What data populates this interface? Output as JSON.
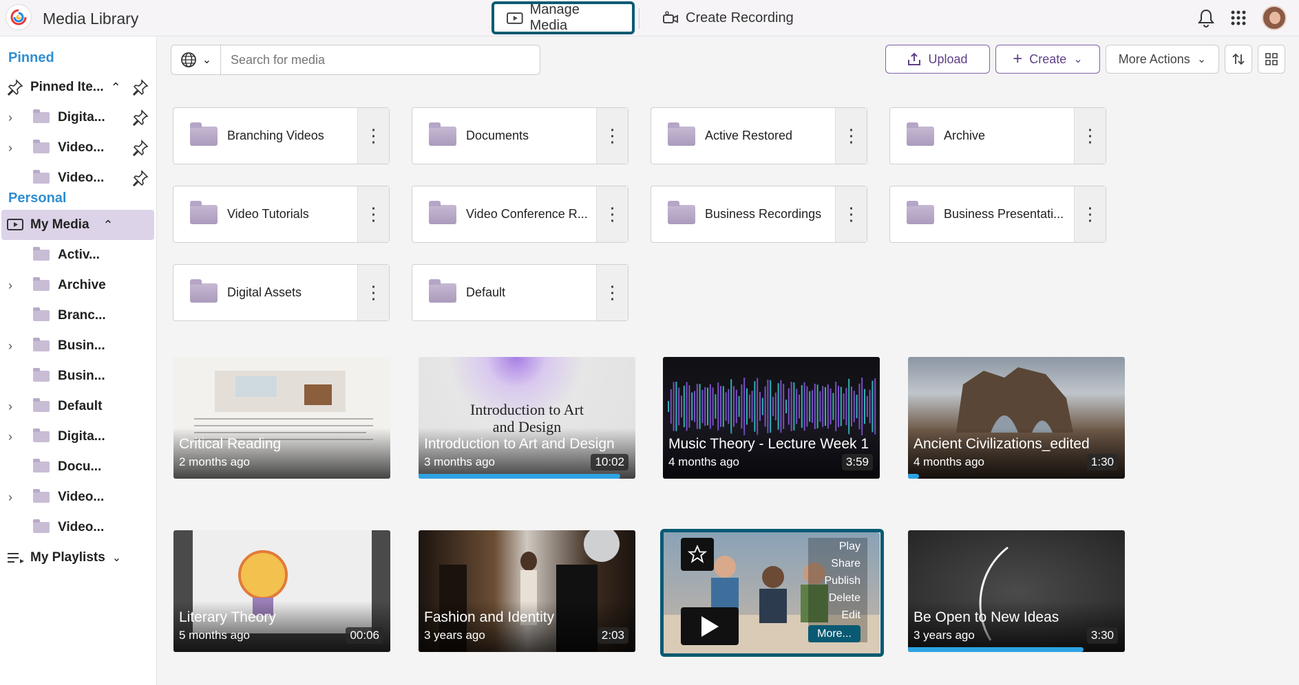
{
  "app": {
    "title": "Media Library"
  },
  "nav": {
    "tabs": [
      {
        "label": "Manage Media"
      },
      {
        "label": "Create Recording"
      }
    ]
  },
  "sidebar": {
    "pinned_title": "Pinned",
    "pinned_items": [
      {
        "label": "Pinned Ite..."
      },
      {
        "label": "Digita..."
      },
      {
        "label": "Video..."
      },
      {
        "label": "Video..."
      }
    ],
    "personal_title": "Personal",
    "my_media": "My Media",
    "folders": [
      {
        "label": "Activ..."
      },
      {
        "label": "Archive"
      },
      {
        "label": "Branc..."
      },
      {
        "label": "Busin..."
      },
      {
        "label": "Busin..."
      },
      {
        "label": "Default"
      },
      {
        "label": "Digita..."
      },
      {
        "label": "Docu..."
      },
      {
        "label": "Video..."
      },
      {
        "label": "Video..."
      }
    ],
    "my_playlists": "My Playlists"
  },
  "toolbar": {
    "search_placeholder": "Search for media",
    "upload": "Upload",
    "create": "Create",
    "more_actions": "More Actions"
  },
  "folders": [
    {
      "name": "Branching Videos"
    },
    {
      "name": "Documents"
    },
    {
      "name": "Active Restored"
    },
    {
      "name": "Archive"
    },
    {
      "name": "Video Tutorials"
    },
    {
      "name": "Video Conference R..."
    },
    {
      "name": "Business Recordings"
    },
    {
      "name": "Business Presentati..."
    },
    {
      "name": "Digital Assets"
    },
    {
      "name": "Default"
    }
  ],
  "media": [
    {
      "title": "Critical Reading",
      "age": "2 months ago",
      "duration": "",
      "progress": 0
    },
    {
      "title": "Introduction to Art and Design",
      "age": "3 months ago",
      "duration": "10:02",
      "progress": 0.93,
      "overlay": "Introduction to Art and Design"
    },
    {
      "title": "Music Theory - Lecture Week 1",
      "age": "4 months ago",
      "duration": "3:59",
      "progress": 0
    },
    {
      "title": "Ancient Civilizations_edited",
      "age": "4 months ago",
      "duration": "1:30",
      "progress": 0.05
    },
    {
      "title": "Literary Theory",
      "age": "5 months ago",
      "duration": "00:06",
      "progress": 0
    },
    {
      "title": "Fashion and Identity",
      "age": "3 years ago",
      "duration": "2:03",
      "progress": 0
    },
    {
      "title": "",
      "age": "",
      "duration": "",
      "progress": 0
    },
    {
      "title": "Be Open to New Ideas",
      "age": "3 years ago",
      "duration": "3:30",
      "progress": 0.81
    }
  ],
  "hover_menu": {
    "items": [
      "Play",
      "Share",
      "Publish",
      "Delete",
      "Edit"
    ],
    "more": "More..."
  }
}
